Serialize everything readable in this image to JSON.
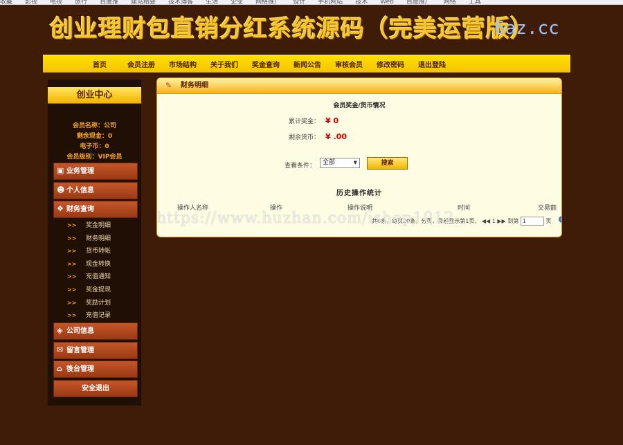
{
  "bookmarks": [
    "收藏",
    "影视",
    "电视",
    "旅行",
    "百度推",
    "建站精要",
    "技术博客",
    "生活",
    "企业",
    "网络推广",
    "设计",
    "手机网站",
    "技术",
    "Web",
    "百度推广",
    "网络",
    "工具"
  ],
  "banner": {
    "title": "创业理财包直销分红系统源码（完美运营版）",
    "site": "6az.cc"
  },
  "topnav": [
    "首页",
    "会员注册",
    "市场结构",
    "关于我们",
    "奖金查询",
    "新闻公告",
    "审核会员",
    "修改密码",
    "退出登陆"
  ],
  "sidebar": {
    "header": "创业中心",
    "member": {
      "name": "会员名称：公司",
      "cash": "剩余现金：0",
      "ecoin": "电子币：0",
      "level": "会员级别：VIP会员"
    },
    "menu": {
      "business": "业务管理",
      "personal": "个人信息",
      "finance": "财务查询",
      "company": "公司信息",
      "message": "留言管理",
      "backend": "後台管理",
      "logout": "安全退出"
    },
    "finance_items": [
      "奖金明细",
      "财务明细",
      "货币转帐",
      "现金转换",
      "充值通知",
      "奖金提现",
      "奖励计划",
      "充值记录"
    ]
  },
  "panel": {
    "title": "财务明细",
    "subtitle": "会员奖金/货币情况",
    "total_bonus_label": "累计奖金：",
    "total_bonus_value": "¥ 0",
    "balance_label": "剩余货币：",
    "balance_value": "¥ .00",
    "filter_label": "查看条件：",
    "filter_value": "全部",
    "search_label": "搜索",
    "history_title": "历史操作统计",
    "columns": [
      "操作人名称",
      "操作",
      "操作说明",
      "时间",
      "交易额"
    ],
    "pager": {
      "summary": "共0条，每页20条，分页，目前显示第1页，",
      "current": "1",
      "goto": "到第",
      "input": "1",
      "suffix": "页"
    }
  },
  "watermark": "https://www.huzhan.com/ishop1012"
}
